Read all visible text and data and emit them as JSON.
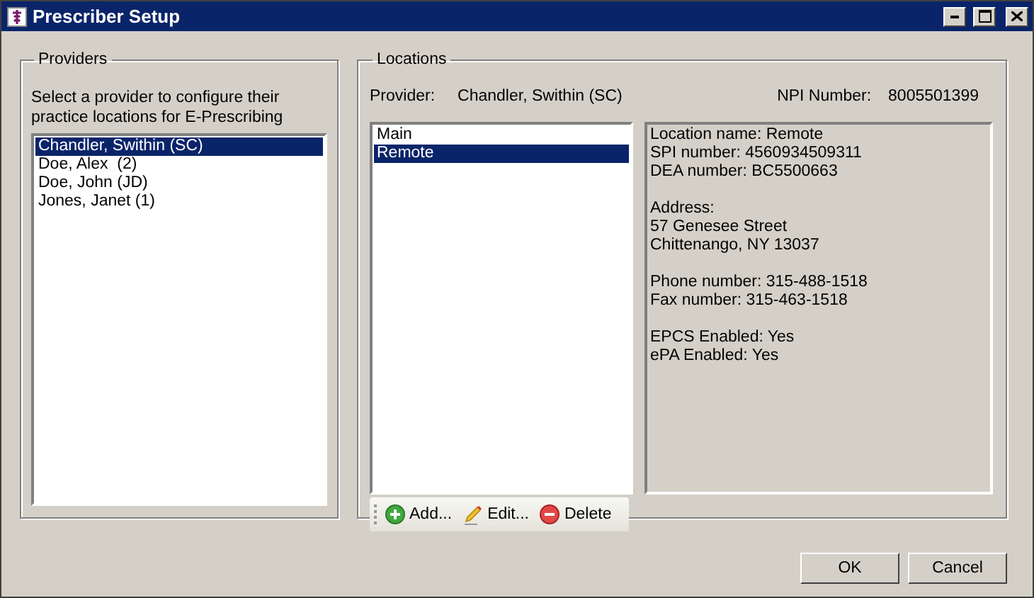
{
  "window": {
    "title": "Prescriber Setup"
  },
  "providers": {
    "legend": "Providers",
    "instructions": "Select a provider to configure their practice locations for E-Prescribing",
    "items": [
      {
        "label": "Chandler, Swithin (SC)",
        "selected": true
      },
      {
        "label": "Doe, Alex  (2)",
        "selected": false
      },
      {
        "label": "Doe, John (JD)",
        "selected": false
      },
      {
        "label": "Jones, Janet (1)",
        "selected": false
      }
    ]
  },
  "locations": {
    "legend": "Locations",
    "provider_label": "Provider:",
    "provider_value": "Chandler, Swithin (SC)",
    "npi_label": "NPI Number:",
    "npi_value": "8005501399",
    "items": [
      {
        "label": "Main",
        "selected": false
      },
      {
        "label": "Remote",
        "selected": true
      }
    ],
    "details": [
      [
        "Location name: Remote",
        "SPI number: 4560934509311",
        "DEA number: BC5500663"
      ],
      [
        "Address:",
        "57 Genesee Street",
        "Chittenango, NY 13037"
      ],
      [
        "Phone number: 315-488-1518",
        "Fax number: 315-463-1518"
      ],
      [
        "EPCS Enabled: Yes",
        "ePA Enabled: Yes"
      ]
    ],
    "toolbar": [
      {
        "kind": "add",
        "label": "Add..."
      },
      {
        "kind": "edit",
        "label": "Edit..."
      },
      {
        "kind": "delete",
        "label": "Delete"
      }
    ]
  },
  "buttons": [
    "OK",
    "Cancel"
  ]
}
